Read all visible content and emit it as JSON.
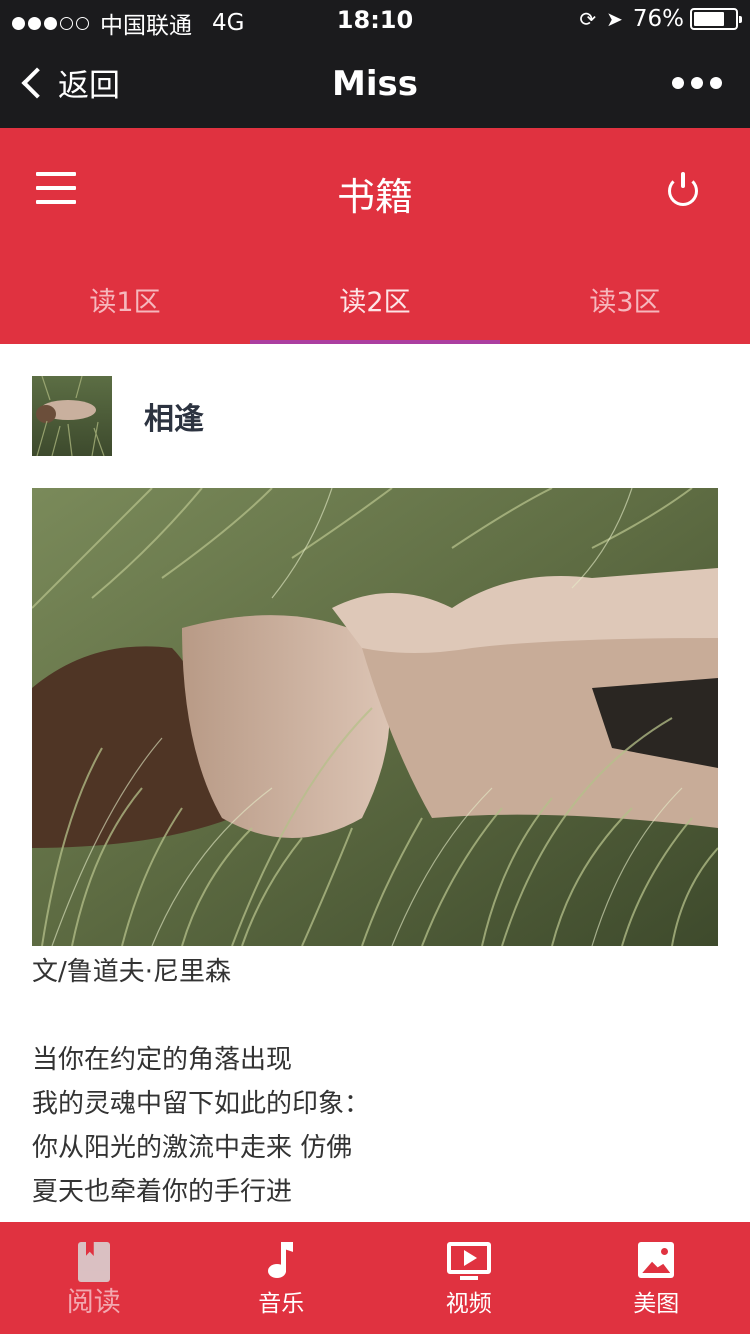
{
  "status_bar": {
    "carrier": "中国联通",
    "network": "4G",
    "time": "18:10",
    "battery": "76%",
    "battery_level": 0.76,
    "signal_bars_filled": 3,
    "signal_bars_total": 5
  },
  "nav_bar": {
    "back_label": "返回",
    "title": "Miss"
  },
  "header": {
    "title": "书籍",
    "tabs": [
      {
        "label": "读1区"
      },
      {
        "label": "读2区"
      },
      {
        "label": "读3区"
      }
    ],
    "active_tab": 1
  },
  "post": {
    "title": "相逢",
    "author": "文/鲁道夫·尼里森",
    "lines": [
      "当你在约定的角落出现",
      "我的灵魂中留下如此的印象：",
      "你从阳光的激流中走来 仿佛",
      "夏天也牵着你的手行进"
    ]
  },
  "tab_bar": {
    "items": [
      {
        "label": "阅读",
        "icon": "book-icon"
      },
      {
        "label": "音乐",
        "icon": "music-note-icon"
      },
      {
        "label": "视频",
        "icon": "video-icon"
      },
      {
        "label": "美图",
        "icon": "picture-icon"
      }
    ],
    "active": 0
  },
  "colors": {
    "brand_red": "#e03240",
    "dark_bar": "#1b1b1d",
    "tab_indicator": "#ab3ea0"
  }
}
